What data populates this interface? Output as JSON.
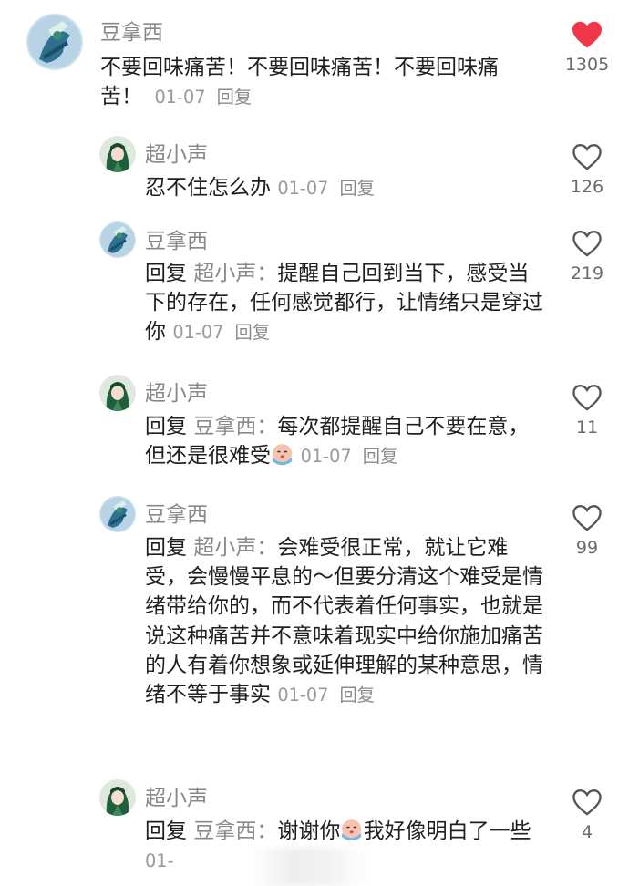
{
  "colors": {
    "liked": "#f0374a",
    "text": "#1f1f1f",
    "muted": "#8a8a8a"
  },
  "comments": [
    {
      "username": "豆拿西",
      "text": "不要回味痛苦！不要回味痛苦！不要回味痛苦！",
      "date": "01-07",
      "reply_label": "回复",
      "likes": "1305",
      "liked": true,
      "avatar_icon": "fairy-avatar-icon"
    },
    {
      "username": "超小声",
      "text": "忍不住怎么办",
      "date": "01-07",
      "reply_label": "回复",
      "likes": "126",
      "liked": false,
      "avatar_icon": "green-hair-avatar-icon"
    },
    {
      "username": "豆拿西",
      "reply_prefix": "回复",
      "reply_to": "超小声：",
      "text": "提醒自己回到当下，感受当下的存在，任何感觉都行，让情绪只是穿过你",
      "date": "01-07",
      "reply_label": "回复",
      "likes": "219",
      "liked": false,
      "avatar_icon": "fairy-avatar-icon"
    },
    {
      "username": "超小声",
      "reply_prefix": "回复",
      "reply_to": "豆拿西：",
      "text": "每次都提醒自己不要在意，但还是很难受",
      "emoji": "crying-face-emoji",
      "date": "01-07",
      "reply_label": "回复",
      "likes": "11",
      "liked": false,
      "avatar_icon": "green-hair-avatar-icon"
    },
    {
      "username": "豆拿西",
      "reply_prefix": "回复",
      "reply_to": "超小声：",
      "text": "会难受很正常，就让它难受，会慢慢平息的～但要分清这个难受是情绪带给你的，而不代表着任何事实，也就是说这种痛苦并不意味着现实中给你施加痛苦的人有着你想象或延伸理解的某种意思，情绪不等于事实",
      "date": "01-07",
      "reply_label": "回复",
      "likes": "99",
      "liked": false,
      "avatar_icon": "fairy-avatar-icon"
    },
    {
      "username": "超小声",
      "reply_prefix": "回复",
      "reply_to": "豆拿西：",
      "text_before": "谢谢你",
      "emoji": "crying-face-emoji",
      "text": "我好像明白了一些",
      "date": "01-",
      "likes": "4",
      "liked": false,
      "avatar_icon": "green-hair-avatar-icon"
    }
  ]
}
